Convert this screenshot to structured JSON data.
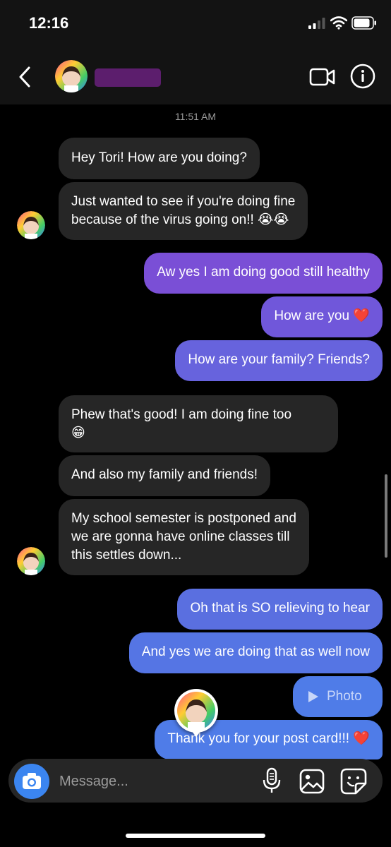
{
  "status_bar": {
    "time": "12:16"
  },
  "header": {
    "contact_name": "",
    "avatar": "user-avatar-icon"
  },
  "chat": {
    "timestamp": "11:51 AM",
    "messages": [
      {
        "sender": "them",
        "text": "Hey Tori! How are you doing?"
      },
      {
        "sender": "them",
        "line1": "Just wanted to see if you're doing fine",
        "line2": "because of the virus going on!! 😭😭"
      },
      {
        "sender": "me",
        "text": "Aw yes I am doing good still healthy"
      },
      {
        "sender": "me",
        "text": "How are you ❤️"
      },
      {
        "sender": "me",
        "text": "How are your family? Friends?"
      },
      {
        "sender": "them",
        "line1": "Phew that's good! I am doing fine too",
        "line2": "😁"
      },
      {
        "sender": "them",
        "text": "And also my family and friends!"
      },
      {
        "sender": "them",
        "line1": "My school semester is postponed and",
        "line2": "we are gonna have online classes till",
        "line3": "this settles down..."
      },
      {
        "sender": "me",
        "text": "Oh that is SO relieving to hear"
      },
      {
        "sender": "me",
        "text": "And yes we are doing that as well now"
      },
      {
        "sender": "me",
        "type": "photo",
        "label": "Photo"
      },
      {
        "sender": "me",
        "text": "Thank you for your post card!!! ❤️"
      }
    ]
  },
  "composer": {
    "placeholder": "Message..."
  },
  "colors": {
    "incoming_bubble": "#262626",
    "purple_top": "#7a4fd6",
    "purple_bottom": "#6763dd",
    "blue_top": "#5a6fe0",
    "blue_bottom": "#4f7ce8",
    "camera_button": "#3b85f0",
    "redaction": "#5c1e6d"
  }
}
